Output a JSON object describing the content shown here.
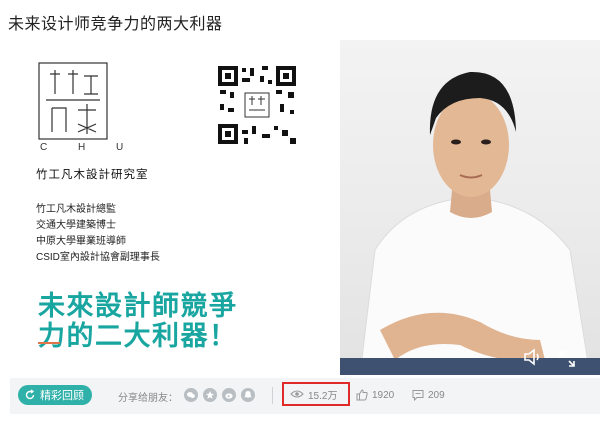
{
  "page": {
    "title": "未来设计师竞争力的两大利器"
  },
  "slide": {
    "logo_caption": "C H U",
    "studio_name": "竹工凡木設計研究室",
    "credentials": [
      "竹工凡木設計總監",
      "交通大學建築博士",
      "中原大學畢業班導師",
      "CSID室內設計協會副理事長"
    ],
    "headline_line1": "未來設計師競爭",
    "headline_line2": "力的二大利器！",
    "headline_color": "#1aa6a0"
  },
  "controls": {
    "mute_icon": "speaker-icon",
    "fullscreen_icon": "expand-icon"
  },
  "bottom_bar": {
    "replay_label": "精彩回顾",
    "share_label": "分享给朋友：",
    "share_icons": [
      "wechat-icon",
      "qzone-icon",
      "weibo-icon",
      "qq-icon"
    ],
    "views": "15.2万",
    "likes": "1920",
    "comments": "209",
    "accent_color": "#2fb1a9",
    "highlight_color": "#e02a2a"
  }
}
